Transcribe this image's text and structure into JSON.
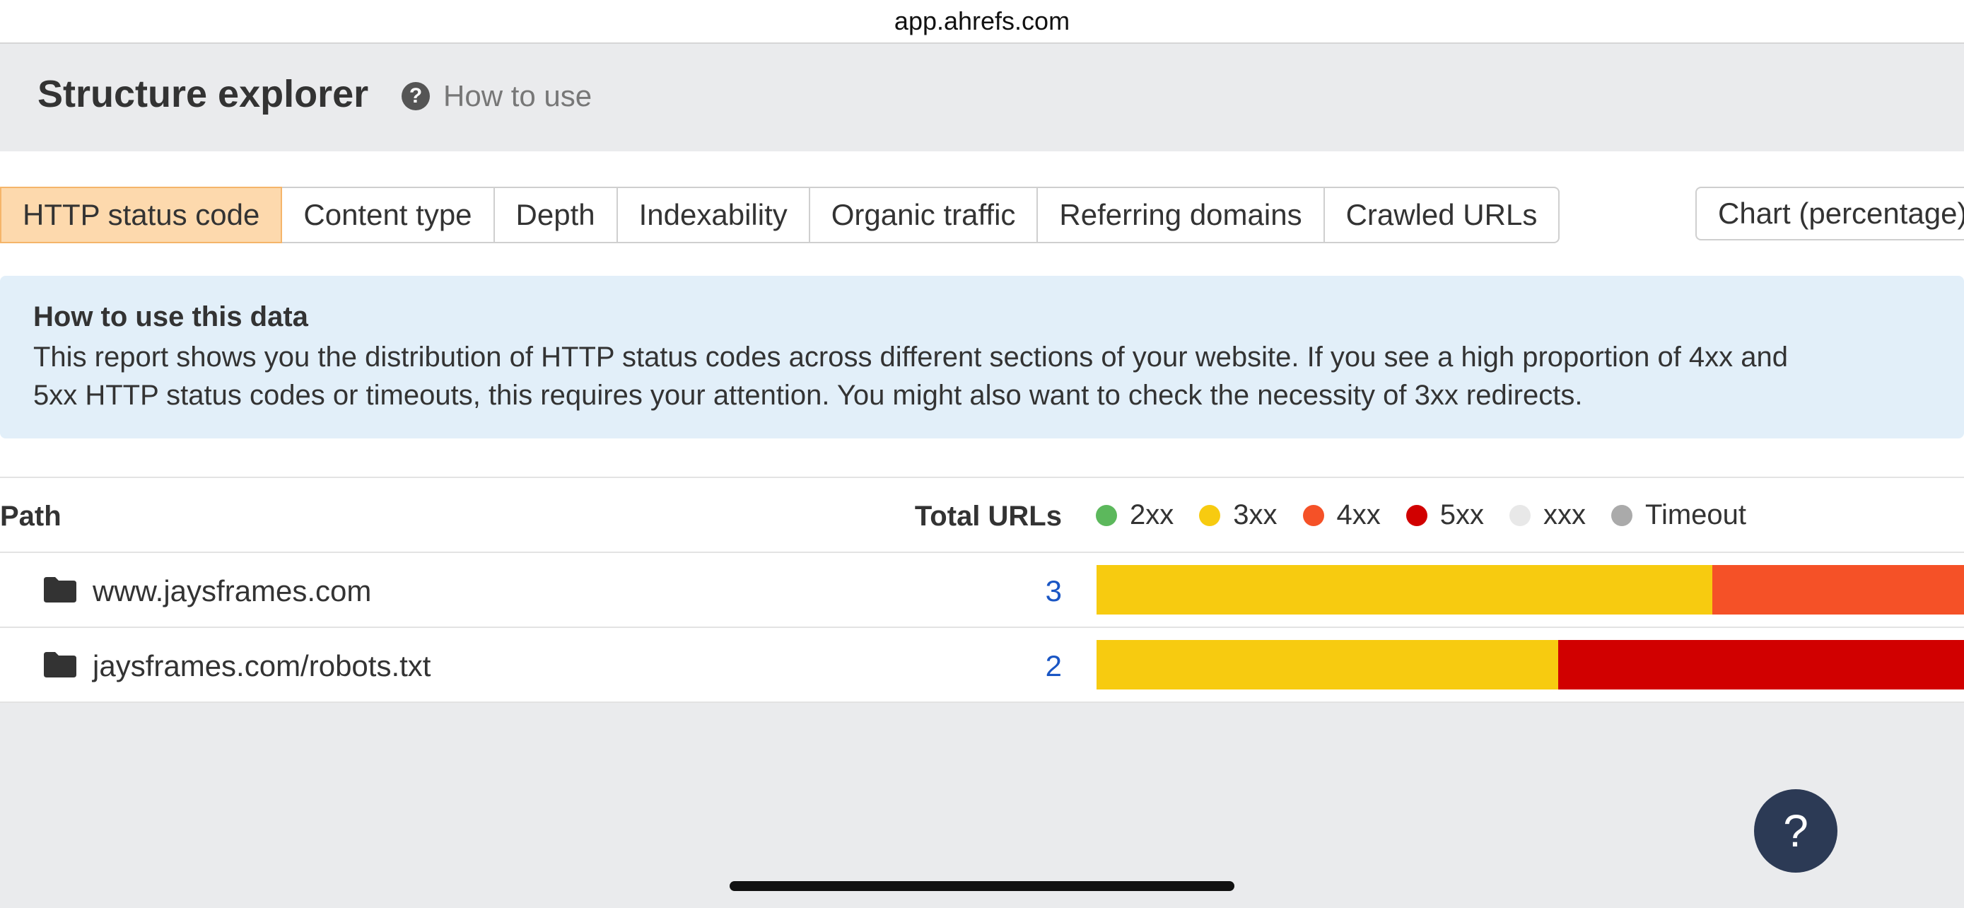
{
  "browser": {
    "url": "app.ahrefs.com"
  },
  "header": {
    "title": "Structure explorer",
    "help_icon": "question-circle-icon",
    "help_link": "How to use"
  },
  "tabs": [
    {
      "label": "HTTP status code",
      "active": true
    },
    {
      "label": "Content type",
      "active": false
    },
    {
      "label": "Depth",
      "active": false
    },
    {
      "label": "Indexability",
      "active": false
    },
    {
      "label": "Organic traffic",
      "active": false
    },
    {
      "label": "Referring domains",
      "active": false
    },
    {
      "label": "Crawled URLs",
      "active": false
    }
  ],
  "view_select": {
    "value": "Chart (percentage)"
  },
  "info": {
    "title": "How to use this data",
    "body": "This report shows you the distribution of HTTP status codes across different sections of your website. If you see a high proportion of 4xx and 5xx HTTP status codes or timeouts, this requires your attention. You might also want to check the necessity of 3xx redirects."
  },
  "table": {
    "col_path": "Path",
    "col_total": "Total URLs",
    "legend": [
      {
        "label": "2xx",
        "color": "#5cb85c"
      },
      {
        "label": "3xx",
        "color": "#f7cb10"
      },
      {
        "label": "4xx",
        "color": "#f55127"
      },
      {
        "label": "5xx",
        "color": "#d10000"
      },
      {
        "label": "xxx",
        "color": "#e8e8e8"
      },
      {
        "label": "Timeout",
        "color": "#aaaaaa"
      }
    ],
    "rows": [
      {
        "icon": "folder-icon",
        "path": "www.jaysframes.com",
        "total": "3",
        "segments": [
          {
            "status": "3xx",
            "color": "#f7cb10",
            "share": 0.7101
          },
          {
            "status": "4xx",
            "color": "#f55127",
            "share": 0.2899
          }
        ]
      },
      {
        "icon": "folder-icon",
        "path": "jaysframes.com/robots.txt",
        "total": "2",
        "segments": [
          {
            "status": "3xx",
            "color": "#f7cb10",
            "share": 0.5321
          },
          {
            "status": "5xx",
            "color": "#d10000",
            "share": 0.4679
          }
        ]
      }
    ]
  },
  "help_button": {
    "label": "?"
  }
}
